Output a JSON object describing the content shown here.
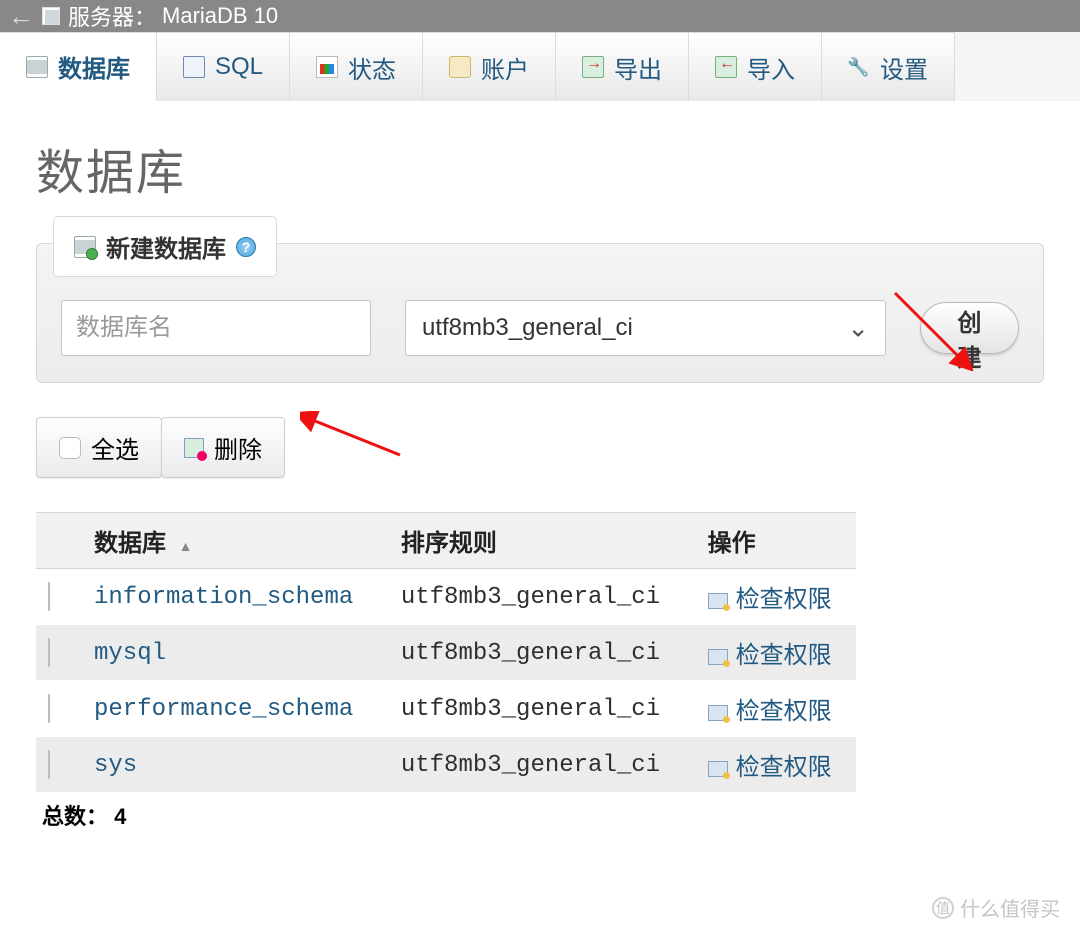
{
  "topbar": {
    "server_label": "服务器：",
    "server_name": "MariaDB 10"
  },
  "tabs": [
    {
      "label": "数据库",
      "active": true
    },
    {
      "label": "SQL",
      "active": false
    },
    {
      "label": "状态",
      "active": false
    },
    {
      "label": "账户",
      "active": false
    },
    {
      "label": "导出",
      "active": false
    },
    {
      "label": "导入",
      "active": false
    },
    {
      "label": "设置",
      "active": false
    }
  ],
  "page": {
    "title": "数据库"
  },
  "create_panel": {
    "legend": "新建数据库",
    "help_symbol": "?",
    "input_placeholder": "数据库名",
    "collation_selected": "utf8mb3_general_ci",
    "create_button": "创建"
  },
  "bulk": {
    "select_all": "全选",
    "delete": "删除"
  },
  "table": {
    "headers": {
      "database": "数据库",
      "collation": "排序规则",
      "action": "操作"
    },
    "action_label": "检查权限",
    "rows": [
      {
        "name": "information_schema",
        "collation": "utf8mb3_general_ci"
      },
      {
        "name": "mysql",
        "collation": "utf8mb3_general_ci"
      },
      {
        "name": "performance_schema",
        "collation": "utf8mb3_general_ci"
      },
      {
        "name": "sys",
        "collation": "utf8mb3_general_ci"
      }
    ],
    "total_label": "总数：",
    "total_value": "4"
  },
  "watermark": {
    "badge": "值",
    "text": "什么值得买"
  }
}
